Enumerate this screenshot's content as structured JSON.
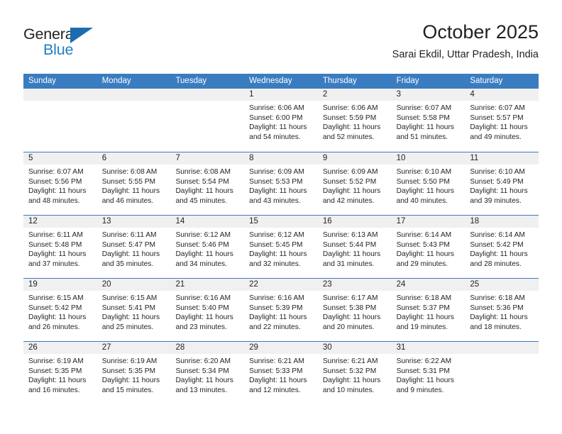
{
  "brand": {
    "name_top": "General",
    "name_bottom": "Blue",
    "accent_color": "#1b6cb0",
    "text_color": "#231f20"
  },
  "header": {
    "title": "October 2025",
    "subtitle": "Sarai Ekdil, Uttar Pradesh, India"
  },
  "calendar": {
    "header_bg": "#3a7cc0",
    "daynum_bg": "#f0f0f0",
    "weekdays": [
      "Sunday",
      "Monday",
      "Tuesday",
      "Wednesday",
      "Thursday",
      "Friday",
      "Saturday"
    ],
    "weeks": [
      [
        {
          "day": "",
          "sunrise": "",
          "sunset": "",
          "daylight_line1": "",
          "daylight_line2": "",
          "empty": true
        },
        {
          "day": "",
          "sunrise": "",
          "sunset": "",
          "daylight_line1": "",
          "daylight_line2": "",
          "empty": true
        },
        {
          "day": "",
          "sunrise": "",
          "sunset": "",
          "daylight_line1": "",
          "daylight_line2": "",
          "empty": true
        },
        {
          "day": "1",
          "sunrise": "Sunrise: 6:06 AM",
          "sunset": "Sunset: 6:00 PM",
          "daylight_line1": "Daylight: 11 hours",
          "daylight_line2": "and 54 minutes."
        },
        {
          "day": "2",
          "sunrise": "Sunrise: 6:06 AM",
          "sunset": "Sunset: 5:59 PM",
          "daylight_line1": "Daylight: 11 hours",
          "daylight_line2": "and 52 minutes."
        },
        {
          "day": "3",
          "sunrise": "Sunrise: 6:07 AM",
          "sunset": "Sunset: 5:58 PM",
          "daylight_line1": "Daylight: 11 hours",
          "daylight_line2": "and 51 minutes."
        },
        {
          "day": "4",
          "sunrise": "Sunrise: 6:07 AM",
          "sunset": "Sunset: 5:57 PM",
          "daylight_line1": "Daylight: 11 hours",
          "daylight_line2": "and 49 minutes."
        }
      ],
      [
        {
          "day": "5",
          "sunrise": "Sunrise: 6:07 AM",
          "sunset": "Sunset: 5:56 PM",
          "daylight_line1": "Daylight: 11 hours",
          "daylight_line2": "and 48 minutes."
        },
        {
          "day": "6",
          "sunrise": "Sunrise: 6:08 AM",
          "sunset": "Sunset: 5:55 PM",
          "daylight_line1": "Daylight: 11 hours",
          "daylight_line2": "and 46 minutes."
        },
        {
          "day": "7",
          "sunrise": "Sunrise: 6:08 AM",
          "sunset": "Sunset: 5:54 PM",
          "daylight_line1": "Daylight: 11 hours",
          "daylight_line2": "and 45 minutes."
        },
        {
          "day": "8",
          "sunrise": "Sunrise: 6:09 AM",
          "sunset": "Sunset: 5:53 PM",
          "daylight_line1": "Daylight: 11 hours",
          "daylight_line2": "and 43 minutes."
        },
        {
          "day": "9",
          "sunrise": "Sunrise: 6:09 AM",
          "sunset": "Sunset: 5:52 PM",
          "daylight_line1": "Daylight: 11 hours",
          "daylight_line2": "and 42 minutes."
        },
        {
          "day": "10",
          "sunrise": "Sunrise: 6:10 AM",
          "sunset": "Sunset: 5:50 PM",
          "daylight_line1": "Daylight: 11 hours",
          "daylight_line2": "and 40 minutes."
        },
        {
          "day": "11",
          "sunrise": "Sunrise: 6:10 AM",
          "sunset": "Sunset: 5:49 PM",
          "daylight_line1": "Daylight: 11 hours",
          "daylight_line2": "and 39 minutes."
        }
      ],
      [
        {
          "day": "12",
          "sunrise": "Sunrise: 6:11 AM",
          "sunset": "Sunset: 5:48 PM",
          "daylight_line1": "Daylight: 11 hours",
          "daylight_line2": "and 37 minutes."
        },
        {
          "day": "13",
          "sunrise": "Sunrise: 6:11 AM",
          "sunset": "Sunset: 5:47 PM",
          "daylight_line1": "Daylight: 11 hours",
          "daylight_line2": "and 35 minutes."
        },
        {
          "day": "14",
          "sunrise": "Sunrise: 6:12 AM",
          "sunset": "Sunset: 5:46 PM",
          "daylight_line1": "Daylight: 11 hours",
          "daylight_line2": "and 34 minutes."
        },
        {
          "day": "15",
          "sunrise": "Sunrise: 6:12 AM",
          "sunset": "Sunset: 5:45 PM",
          "daylight_line1": "Daylight: 11 hours",
          "daylight_line2": "and 32 minutes."
        },
        {
          "day": "16",
          "sunrise": "Sunrise: 6:13 AM",
          "sunset": "Sunset: 5:44 PM",
          "daylight_line1": "Daylight: 11 hours",
          "daylight_line2": "and 31 minutes."
        },
        {
          "day": "17",
          "sunrise": "Sunrise: 6:14 AM",
          "sunset": "Sunset: 5:43 PM",
          "daylight_line1": "Daylight: 11 hours",
          "daylight_line2": "and 29 minutes."
        },
        {
          "day": "18",
          "sunrise": "Sunrise: 6:14 AM",
          "sunset": "Sunset: 5:42 PM",
          "daylight_line1": "Daylight: 11 hours",
          "daylight_line2": "and 28 minutes."
        }
      ],
      [
        {
          "day": "19",
          "sunrise": "Sunrise: 6:15 AM",
          "sunset": "Sunset: 5:42 PM",
          "daylight_line1": "Daylight: 11 hours",
          "daylight_line2": "and 26 minutes."
        },
        {
          "day": "20",
          "sunrise": "Sunrise: 6:15 AM",
          "sunset": "Sunset: 5:41 PM",
          "daylight_line1": "Daylight: 11 hours",
          "daylight_line2": "and 25 minutes."
        },
        {
          "day": "21",
          "sunrise": "Sunrise: 6:16 AM",
          "sunset": "Sunset: 5:40 PM",
          "daylight_line1": "Daylight: 11 hours",
          "daylight_line2": "and 23 minutes."
        },
        {
          "day": "22",
          "sunrise": "Sunrise: 6:16 AM",
          "sunset": "Sunset: 5:39 PM",
          "daylight_line1": "Daylight: 11 hours",
          "daylight_line2": "and 22 minutes."
        },
        {
          "day": "23",
          "sunrise": "Sunrise: 6:17 AM",
          "sunset": "Sunset: 5:38 PM",
          "daylight_line1": "Daylight: 11 hours",
          "daylight_line2": "and 20 minutes."
        },
        {
          "day": "24",
          "sunrise": "Sunrise: 6:18 AM",
          "sunset": "Sunset: 5:37 PM",
          "daylight_line1": "Daylight: 11 hours",
          "daylight_line2": "and 19 minutes."
        },
        {
          "day": "25",
          "sunrise": "Sunrise: 6:18 AM",
          "sunset": "Sunset: 5:36 PM",
          "daylight_line1": "Daylight: 11 hours",
          "daylight_line2": "and 18 minutes."
        }
      ],
      [
        {
          "day": "26",
          "sunrise": "Sunrise: 6:19 AM",
          "sunset": "Sunset: 5:35 PM",
          "daylight_line1": "Daylight: 11 hours",
          "daylight_line2": "and 16 minutes."
        },
        {
          "day": "27",
          "sunrise": "Sunrise: 6:19 AM",
          "sunset": "Sunset: 5:35 PM",
          "daylight_line1": "Daylight: 11 hours",
          "daylight_line2": "and 15 minutes."
        },
        {
          "day": "28",
          "sunrise": "Sunrise: 6:20 AM",
          "sunset": "Sunset: 5:34 PM",
          "daylight_line1": "Daylight: 11 hours",
          "daylight_line2": "and 13 minutes."
        },
        {
          "day": "29",
          "sunrise": "Sunrise: 6:21 AM",
          "sunset": "Sunset: 5:33 PM",
          "daylight_line1": "Daylight: 11 hours",
          "daylight_line2": "and 12 minutes."
        },
        {
          "day": "30",
          "sunrise": "Sunrise: 6:21 AM",
          "sunset": "Sunset: 5:32 PM",
          "daylight_line1": "Daylight: 11 hours",
          "daylight_line2": "and 10 minutes."
        },
        {
          "day": "31",
          "sunrise": "Sunrise: 6:22 AM",
          "sunset": "Sunset: 5:31 PM",
          "daylight_line1": "Daylight: 11 hours",
          "daylight_line2": "and 9 minutes."
        },
        {
          "day": "",
          "sunrise": "",
          "sunset": "",
          "daylight_line1": "",
          "daylight_line2": "",
          "empty": true
        }
      ]
    ]
  }
}
